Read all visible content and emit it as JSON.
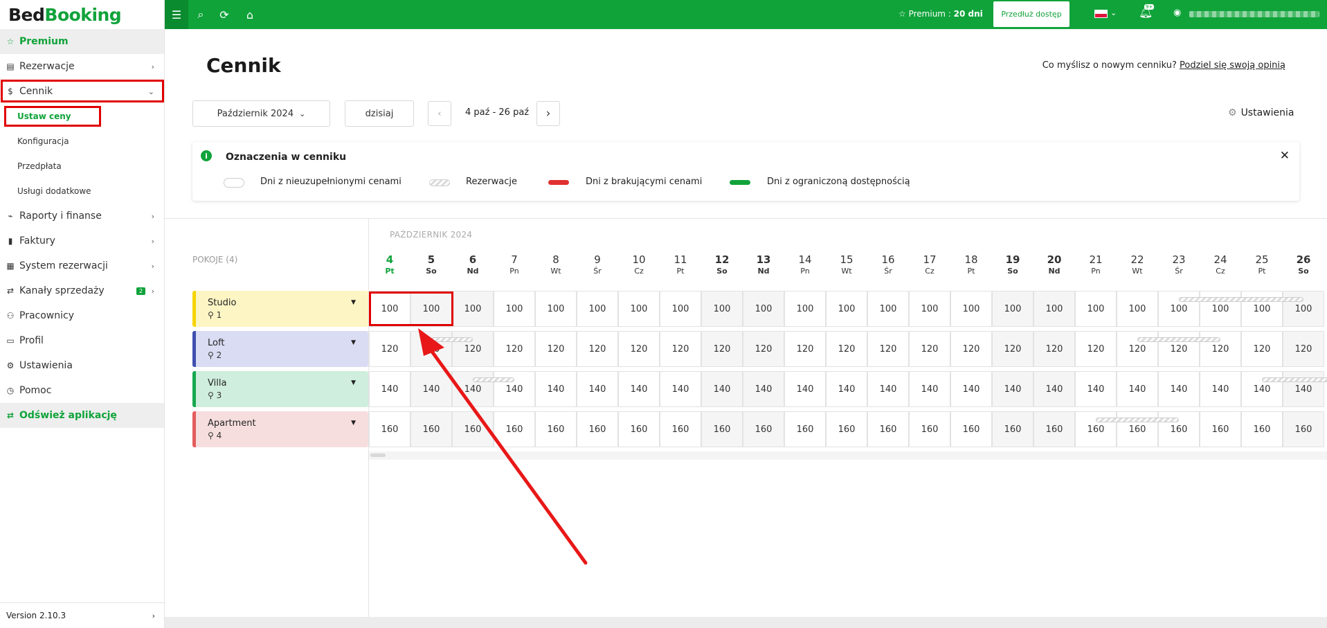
{
  "app": {
    "logo_part1": "Bed",
    "logo_part2": "Booking",
    "version": "Version 2.10.3"
  },
  "sidebar": {
    "premium": "Premium",
    "reservations": "Rezerwacje",
    "pricing": "Cennik",
    "set_prices": "Ustaw ceny",
    "configuration": "Konfiguracja",
    "prepayment": "Przedpłata",
    "extra_services": "Usługi dodatkowe",
    "reports": "Raporty i finanse",
    "invoices": "Faktury",
    "booking_system": "System rezerwacji",
    "sales_channels": "Kanały sprzedaży",
    "sales_channels_badge": "2",
    "employees": "Pracownicy",
    "profile": "Profil",
    "settings": "Ustawienia",
    "help": "Pomoc",
    "refresh": "Odśwież aplikację"
  },
  "topbar": {
    "premium_label": "Premium : ",
    "premium_days": "20 dni",
    "extend_button": "Przedłuż dostęp",
    "notifications_badge": "9+"
  },
  "main": {
    "title": "Cennik",
    "feedback_question": "Co myślisz o nowym cenniku? ",
    "feedback_link": "Podziel się swoją opinią",
    "month_select": "Październik 2024",
    "today_button": "dzisiaj",
    "date_range": "4 paź - 26 paź",
    "settings": "Ustawienia"
  },
  "legend": {
    "title": "Oznaczenia w cenniku",
    "missing_prices_days": "Dni z nieuzupełnionymi cenami",
    "reservations": "Rezerwacje",
    "days_missing_prices": "Dni z brakującymi cenami",
    "limited_availability": "Dni z ograniczoną dostępnością",
    "colors": {
      "missing": "#e03030",
      "limited": "#10a33a"
    }
  },
  "grid": {
    "rooms_label": "POKOJE (4)",
    "month_label": "PAŹDZIERNIK 2024",
    "days": [
      {
        "n": "4",
        "w": "Pt",
        "today": true
      },
      {
        "n": "5",
        "w": "So",
        "weekend": true
      },
      {
        "n": "6",
        "w": "Nd",
        "weekend": true
      },
      {
        "n": "7",
        "w": "Pn"
      },
      {
        "n": "8",
        "w": "Wt"
      },
      {
        "n": "9",
        "w": "Śr"
      },
      {
        "n": "10",
        "w": "Cz"
      },
      {
        "n": "11",
        "w": "Pt"
      },
      {
        "n": "12",
        "w": "So",
        "weekend": true
      },
      {
        "n": "13",
        "w": "Nd",
        "weekend": true
      },
      {
        "n": "14",
        "w": "Pn"
      },
      {
        "n": "15",
        "w": "Wt"
      },
      {
        "n": "16",
        "w": "Śr"
      },
      {
        "n": "17",
        "w": "Cz"
      },
      {
        "n": "18",
        "w": "Pt"
      },
      {
        "n": "19",
        "w": "So",
        "weekend": true
      },
      {
        "n": "20",
        "w": "Nd",
        "weekend": true
      },
      {
        "n": "21",
        "w": "Pn"
      },
      {
        "n": "22",
        "w": "Wt"
      },
      {
        "n": "23",
        "w": "Śr"
      },
      {
        "n": "24",
        "w": "Cz"
      },
      {
        "n": "25",
        "w": "Pt"
      },
      {
        "n": "26",
        "w": "So",
        "weekend": true
      }
    ],
    "rooms": [
      {
        "name": "Studio",
        "capacity": "1",
        "price": "100",
        "color": "#fdf5c4",
        "bar": "#f5d400",
        "reservations": [
          [
            19,
            22
          ]
        ]
      },
      {
        "name": "Loft",
        "capacity": "2",
        "price": "120",
        "color": "#d9dcf2",
        "bar": "#3f4fb0",
        "reservations": [
          [
            1,
            2
          ],
          [
            18,
            20
          ]
        ]
      },
      {
        "name": "Villa",
        "capacity": "3",
        "price": "140",
        "color": "#cfeedd",
        "bar": "#18a850",
        "reservations": [
          [
            2,
            3
          ],
          [
            21,
            23
          ]
        ]
      },
      {
        "name": "Apartment",
        "capacity": "4",
        "price": "160",
        "color": "#f7dede",
        "bar": "#e35d5d",
        "reservations": [
          [
            17,
            19
          ]
        ]
      }
    ]
  }
}
